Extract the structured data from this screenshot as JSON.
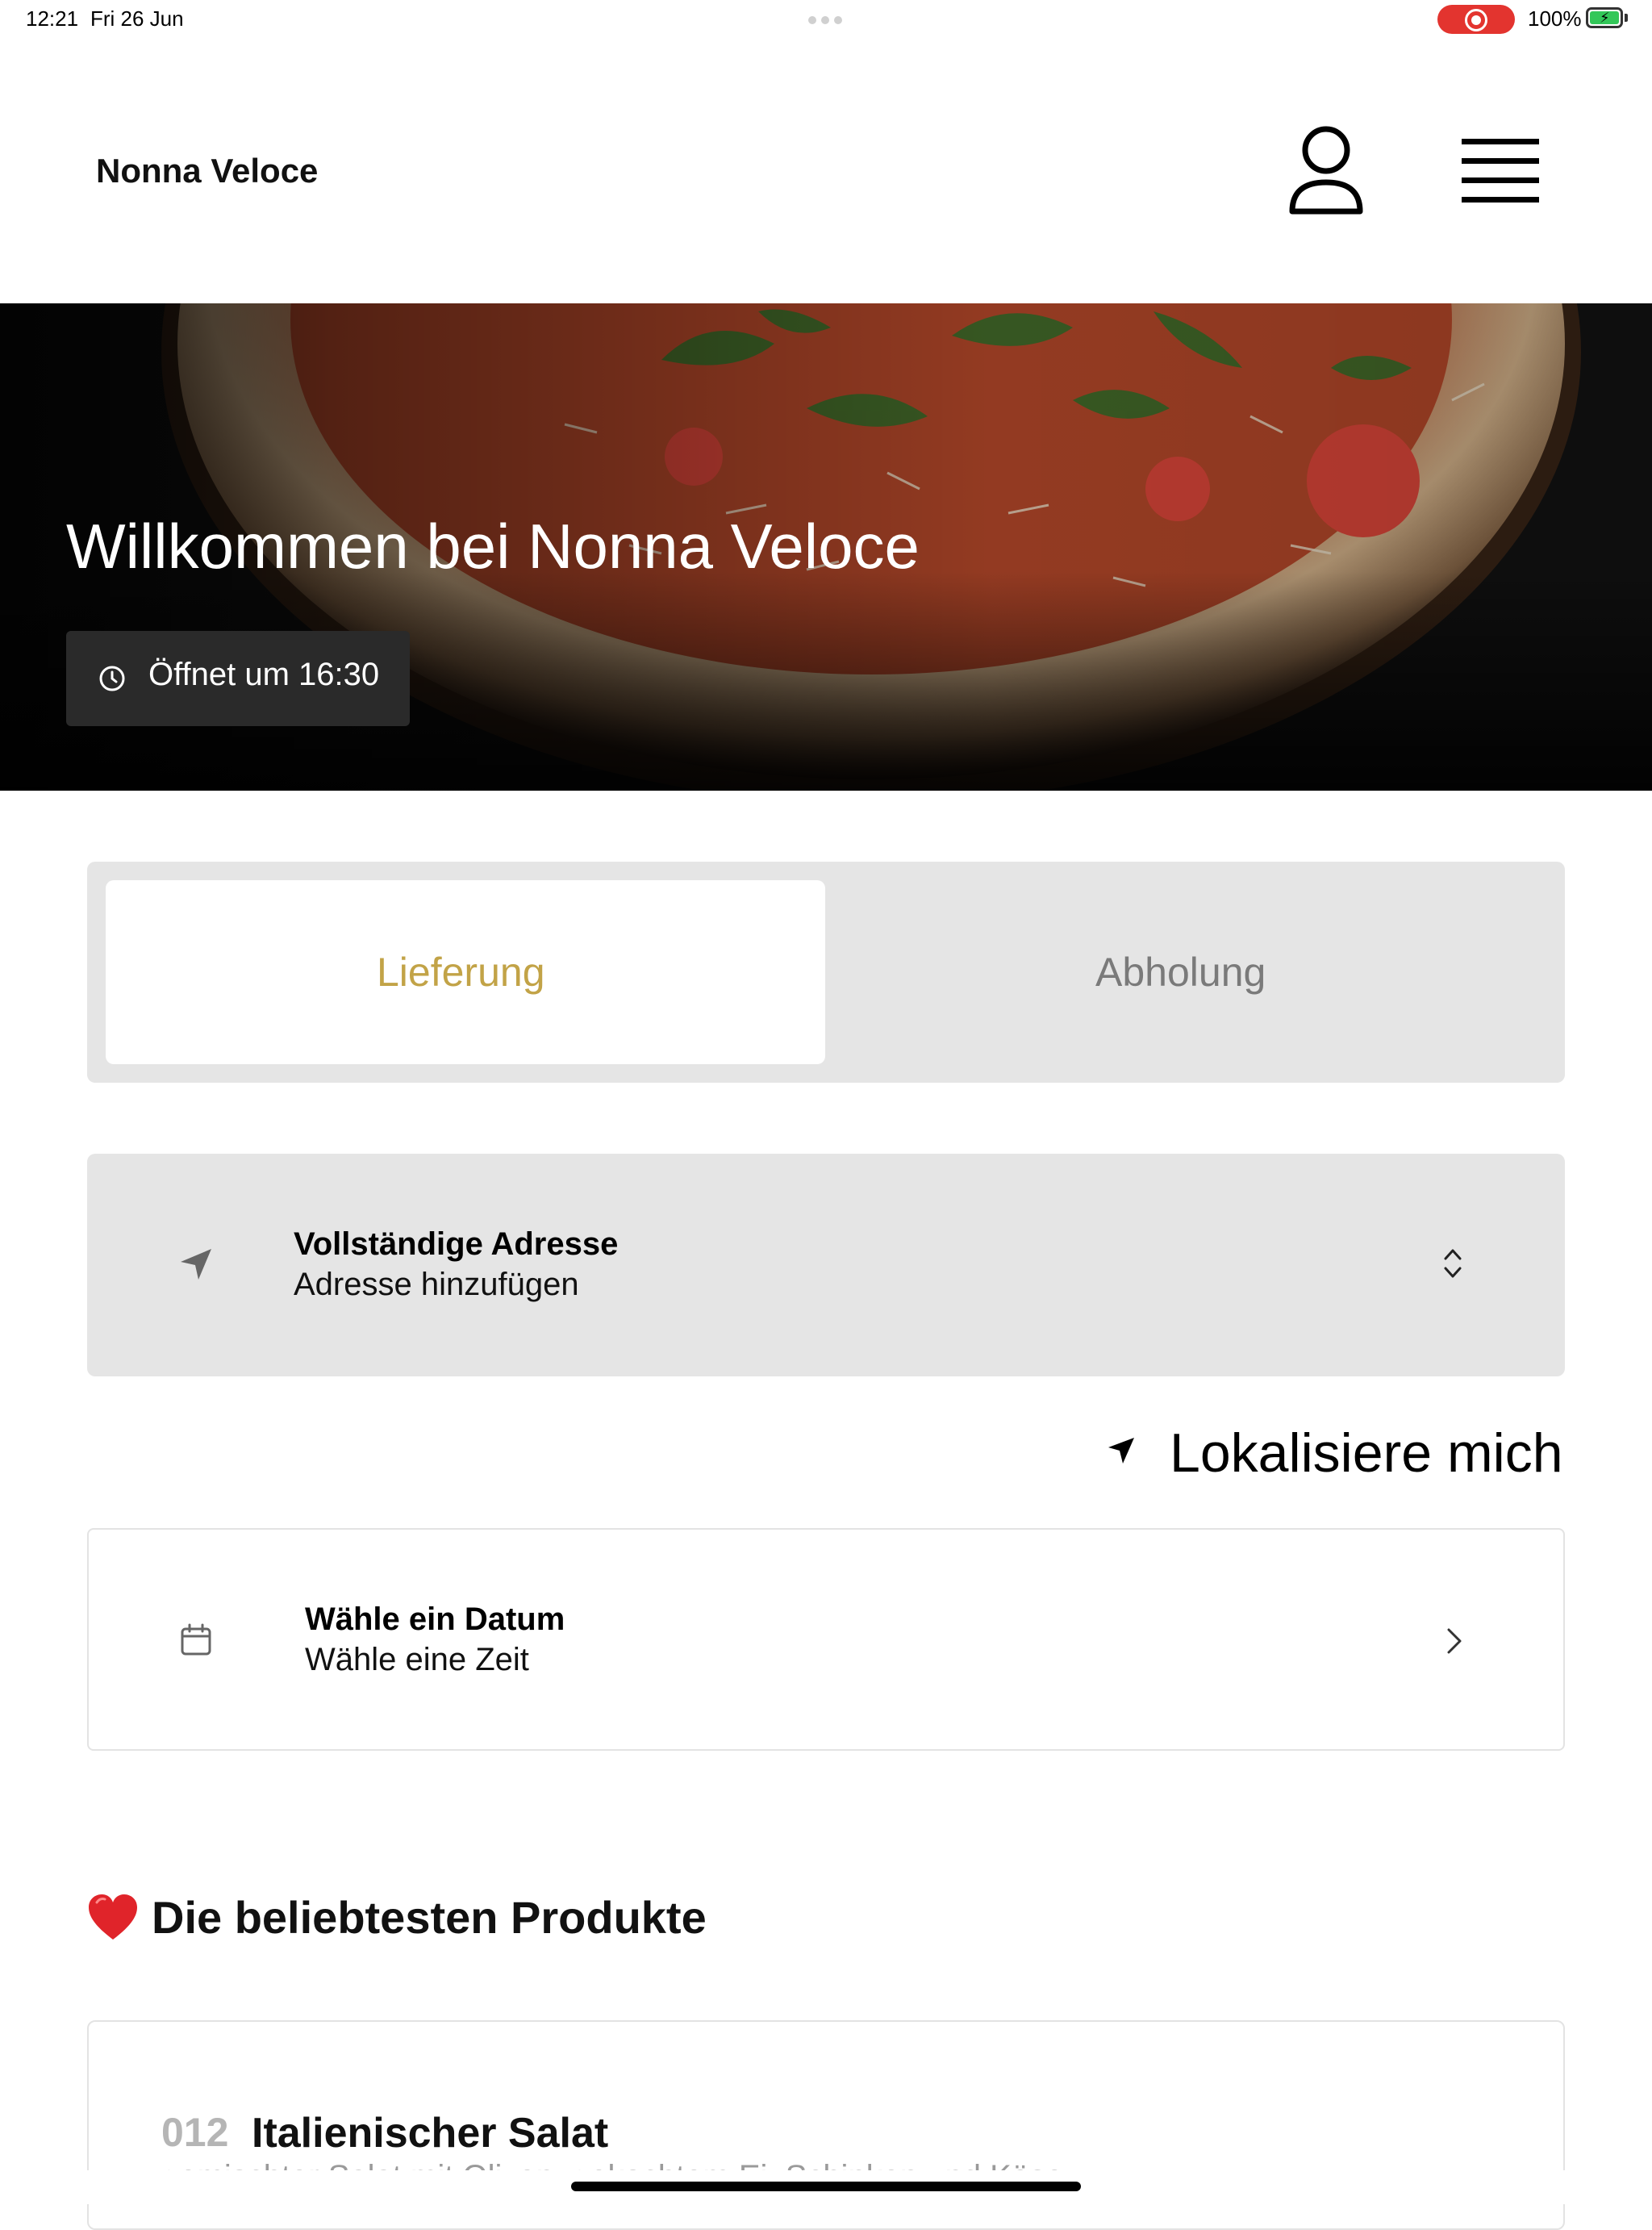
{
  "status_bar": {
    "time": "12:21",
    "date": "Fri 26 Jun",
    "battery": "100%"
  },
  "header": {
    "brand": "Nonna Veloce",
    "profile_icon": "person-icon",
    "menu_icon": "hamburger-menu-icon"
  },
  "hero": {
    "title": "Willkommen bei Nonna Veloce",
    "opening_text": "Öffnet um 16:30",
    "opening_icon": "clock-icon"
  },
  "order_mode": {
    "tabs": [
      {
        "label": "Lieferung",
        "active": true
      },
      {
        "label": "Abholung",
        "active": false
      }
    ],
    "accent_color": "#c2a347"
  },
  "address": {
    "title": "Vollständige Adresse",
    "subtitle": "Adresse hinzufügen",
    "icon": "location-arrow-icon",
    "chevron_icon": "chevron-up-down-icon"
  },
  "locate": {
    "label": "Lokalisiere mich",
    "icon": "location-arrow-icon"
  },
  "schedule": {
    "title": "Wähle ein Datum",
    "subtitle": "Wähle eine Zeit",
    "icon": "calendar-icon",
    "chevron_icon": "chevron-right-icon"
  },
  "popular": {
    "heading": "Die beliebtesten Produkte",
    "heading_icon": "heart-icon",
    "products": [
      {
        "number": "012",
        "name": "Italienischer Salat",
        "description": "gemischter Salat mit Oliven, gekochtem Ei, Schinken und Käse"
      }
    ]
  }
}
